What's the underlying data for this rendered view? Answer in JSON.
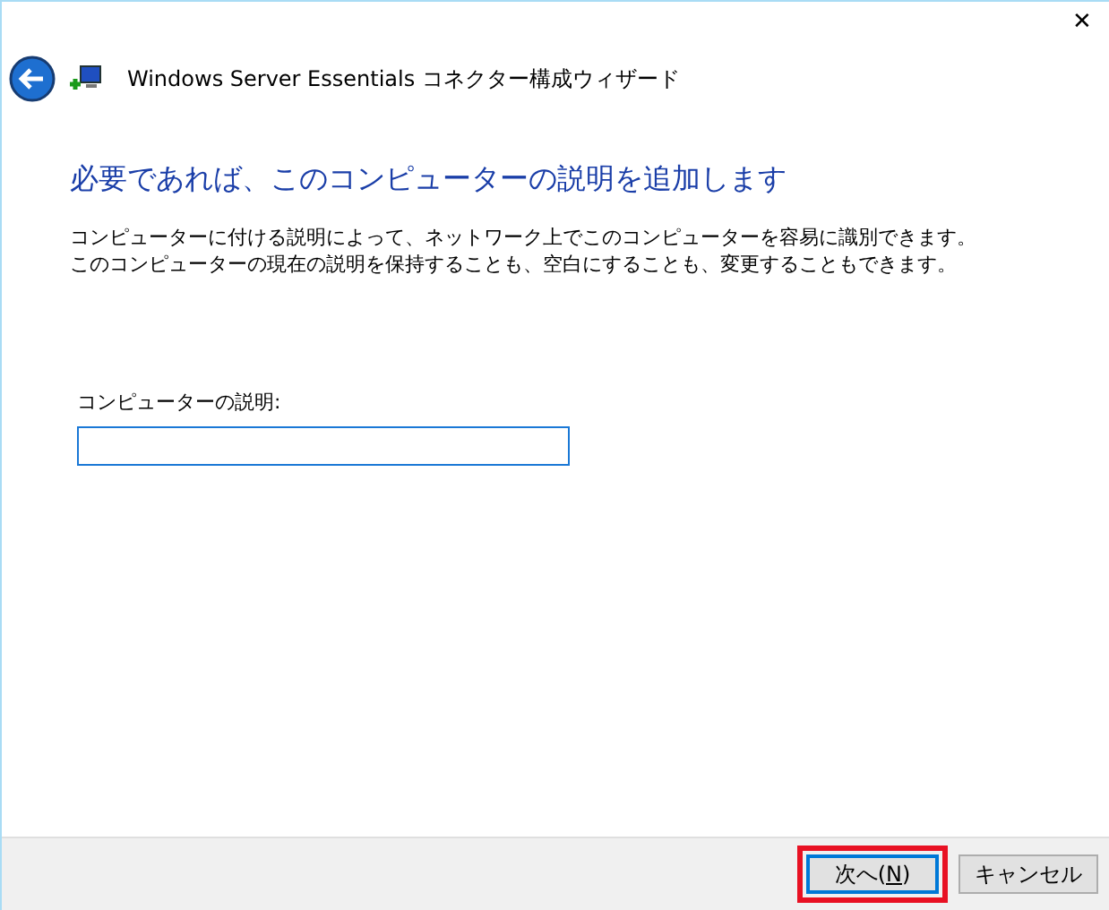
{
  "window": {
    "close": "✕",
    "title": "Windows Server Essentials コネクター構成ウィザード"
  },
  "heading": "必要であれば、このコンピューターの説明を追加します",
  "description": [
    "コンピューターに付ける説明によって、ネットワーク上でこのコンピューターを容易に識別できます。",
    "このコンピューターの現在の説明を保持することも、空白にすることも、変更することもできます。"
  ],
  "field": {
    "label": "コンピューターの説明:",
    "focused": true
  },
  "buttons": [
    {
      "label": "次へ(",
      "access_key": "N",
      "label_end": ")",
      "default": true,
      "highlighted": true
    },
    {
      "label": "キャンセル",
      "default": false,
      "highlighted": false
    }
  ]
}
